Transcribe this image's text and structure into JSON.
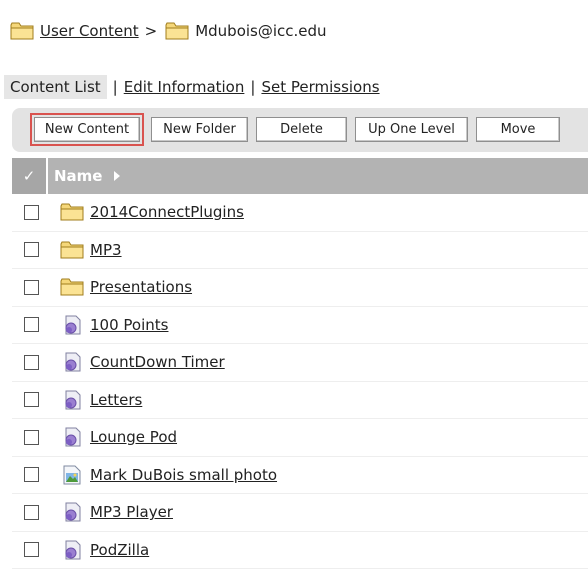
{
  "breadcrumb": {
    "root_label": "User Content",
    "separator": ">",
    "current_label": "Mdubois@icc.edu"
  },
  "tabs": {
    "active": "Content List",
    "separator": "|",
    "edit": "Edit Information",
    "permissions": "Set Permissions"
  },
  "toolbar": {
    "new_content": "New Content",
    "new_folder": "New Folder",
    "delete": "Delete",
    "up_one_level": "Up One Level",
    "move": "Move"
  },
  "table": {
    "header_check": "✓",
    "header_name": "Name",
    "rows": [
      {
        "label": "2014ConnectPlugins",
        "icon": "folder-icon"
      },
      {
        "label": "MP3",
        "icon": "folder-icon"
      },
      {
        "label": "Presentations",
        "icon": "folder-icon"
      },
      {
        "label": "100 Points",
        "icon": "content-icon"
      },
      {
        "label": "CountDown Timer",
        "icon": "content-icon"
      },
      {
        "label": "Letters",
        "icon": "content-icon"
      },
      {
        "label": "Lounge Pod",
        "icon": "content-icon"
      },
      {
        "label": "Mark DuBois small photo",
        "icon": "image-icon"
      },
      {
        "label": "MP3 Player",
        "icon": "content-icon"
      },
      {
        "label": "PodZilla",
        "icon": "content-icon"
      }
    ]
  },
  "colors": {
    "highlight": "#d9534f",
    "header_bg": "#b3b3b3",
    "toolbar_bg": "#e3e3e3"
  }
}
